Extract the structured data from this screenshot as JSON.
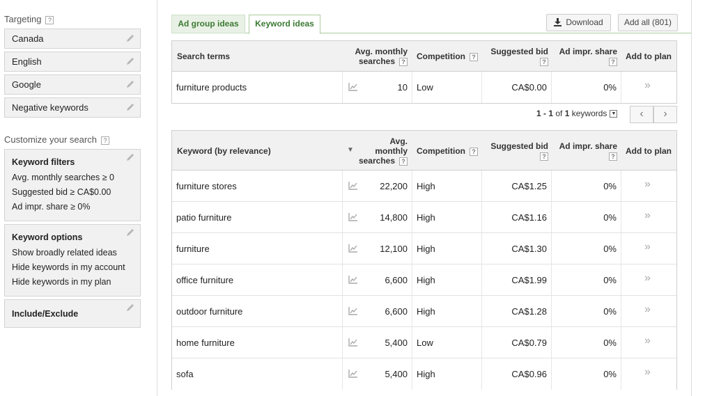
{
  "sidebar": {
    "targeting_title": "Targeting",
    "help_mark": "?",
    "targeting": [
      "Canada",
      "English",
      "Google",
      "Negative keywords"
    ],
    "customize_title": "Customize your search",
    "keyword_filters": {
      "title": "Keyword filters",
      "lines": [
        "Avg. monthly searches ≥ 0",
        "Suggested bid ≥ CA$0.00",
        "Ad impr. share ≥ 0%"
      ]
    },
    "keyword_options": {
      "title": "Keyword options",
      "lines": [
        "Show broadly related ideas",
        "Hide keywords in my account",
        "Hide keywords in my plan"
      ]
    },
    "include_exclude": "Include/Exclude"
  },
  "tabs": [
    {
      "label": "Ad group ideas",
      "active": false
    },
    {
      "label": "Keyword ideas",
      "active": true
    }
  ],
  "toolbar": {
    "download": "Download",
    "add_all": "Add all (801)"
  },
  "search_table": {
    "headers": {
      "term": "Search terms",
      "avg1": "Avg. monthly",
      "avg2": "searches",
      "competition": "Competition",
      "bid": "Suggested bid",
      "share": "Ad impr. share",
      "add": "Add to plan"
    },
    "rows": [
      {
        "keyword": "furniture products",
        "searches": "10",
        "competition": "Low",
        "bid": "CA$0.00",
        "share": "0%"
      }
    ]
  },
  "pager": {
    "range": "1 - 1",
    "of": "of",
    "total": "1",
    "label": "keywords",
    "prev": "‹",
    "next": "›"
  },
  "keyword_table": {
    "headers": {
      "keyword": "Keyword (by relevance)",
      "avg1": "Avg.",
      "avg2": "monthly",
      "avg3": "searches",
      "competition": "Competition",
      "bid": "Suggested bid",
      "share": "Ad impr. share",
      "add": "Add to plan"
    },
    "rows": [
      {
        "keyword": "furniture stores",
        "searches": "22,200",
        "competition": "High",
        "bid": "CA$1.25",
        "share": "0%"
      },
      {
        "keyword": "patio furniture",
        "searches": "14,800",
        "competition": "High",
        "bid": "CA$1.16",
        "share": "0%"
      },
      {
        "keyword": "furniture",
        "searches": "12,100",
        "competition": "High",
        "bid": "CA$1.30",
        "share": "0%"
      },
      {
        "keyword": "office furniture",
        "searches": "6,600",
        "competition": "High",
        "bid": "CA$1.99",
        "share": "0%"
      },
      {
        "keyword": "outdoor furniture",
        "searches": "6,600",
        "competition": "High",
        "bid": "CA$1.28",
        "share": "0%"
      },
      {
        "keyword": "home furniture",
        "searches": "5,400",
        "competition": "Low",
        "bid": "CA$0.79",
        "share": "0%"
      },
      {
        "keyword": "sofa",
        "searches": "5,400",
        "competition": "High",
        "bid": "CA$0.96",
        "share": "0%"
      }
    ]
  },
  "chevron": "»"
}
